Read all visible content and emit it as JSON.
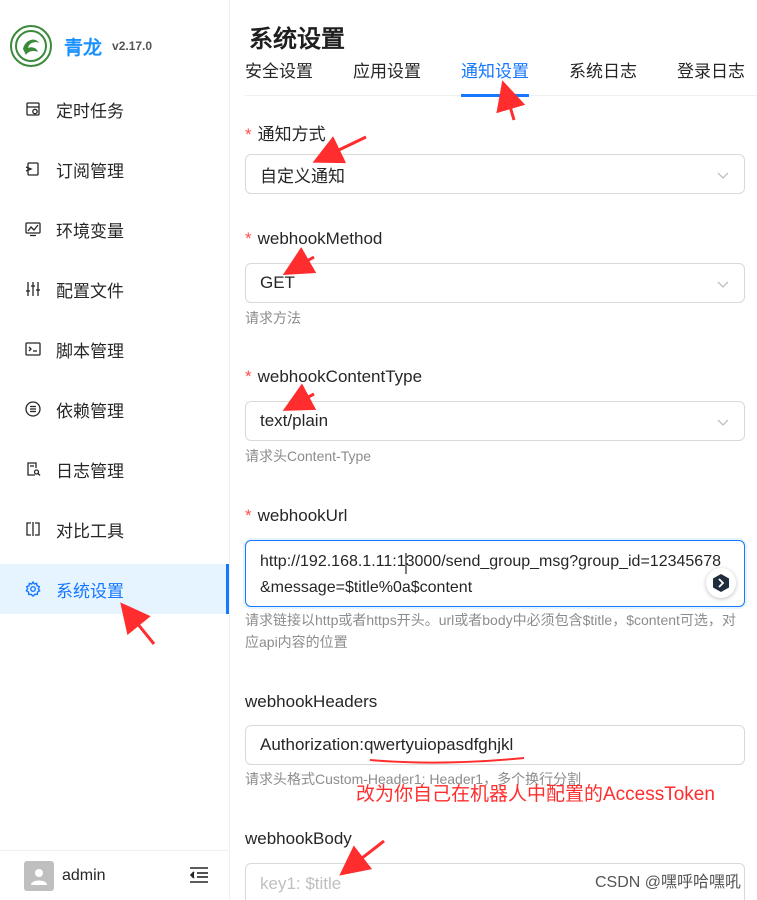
{
  "app": {
    "name": "青龙",
    "version": "v2.17.0"
  },
  "sidebar": {
    "items": [
      {
        "label": "定时任务",
        "icon": "calendar-icon"
      },
      {
        "label": "订阅管理",
        "icon": "subscription-icon"
      },
      {
        "label": "环境变量",
        "icon": "monitor-icon"
      },
      {
        "label": "配置文件",
        "icon": "sliders-icon"
      },
      {
        "label": "脚本管理",
        "icon": "code-icon"
      },
      {
        "label": "依赖管理",
        "icon": "list-icon"
      },
      {
        "label": "日志管理",
        "icon": "file-search-icon"
      },
      {
        "label": "对比工具",
        "icon": "diff-icon"
      },
      {
        "label": "系统设置",
        "icon": "gear-icon"
      }
    ],
    "active_index": 8,
    "user": "admin"
  },
  "main": {
    "title": "系统设置",
    "tabs": [
      "安全设置",
      "应用设置",
      "通知设置",
      "系统日志",
      "登录日志"
    ],
    "active_tab": 2
  },
  "form": {
    "notify_method": {
      "label": "通知方式",
      "value": "自定义通知"
    },
    "webhook_method": {
      "label": "webhookMethod",
      "value": "GET",
      "help": "请求方法"
    },
    "webhook_content_type": {
      "label": "webhookContentType",
      "value": "text/plain",
      "help": "请求头Content-Type"
    },
    "webhook_url": {
      "label": "webhookUrl",
      "value": "http://192.168.1.11:13000/send_group_msg?group_id=12345678&message=$title%0a$content",
      "help": "请求链接以http或者https开头。url或者body中必须包含$title，$content可选，对应api内容的位置"
    },
    "webhook_headers": {
      "label": "webhookHeaders",
      "value": "Authorization:qwertyuiopasdfghjkl",
      "help": "请求头格式Custom-Header1: Header1，多个换行分割"
    },
    "webhook_body": {
      "label": "webhookBody",
      "placeholder": "key1: $title"
    }
  },
  "annotation": "改为你自己在机器人中配置的AccessToken",
  "watermark": "CSDN @嘿呼哈嘿吼",
  "colors": {
    "accent": "#1677ff",
    "required": "#ff4d4f",
    "annotation": "#ff2d2d"
  }
}
